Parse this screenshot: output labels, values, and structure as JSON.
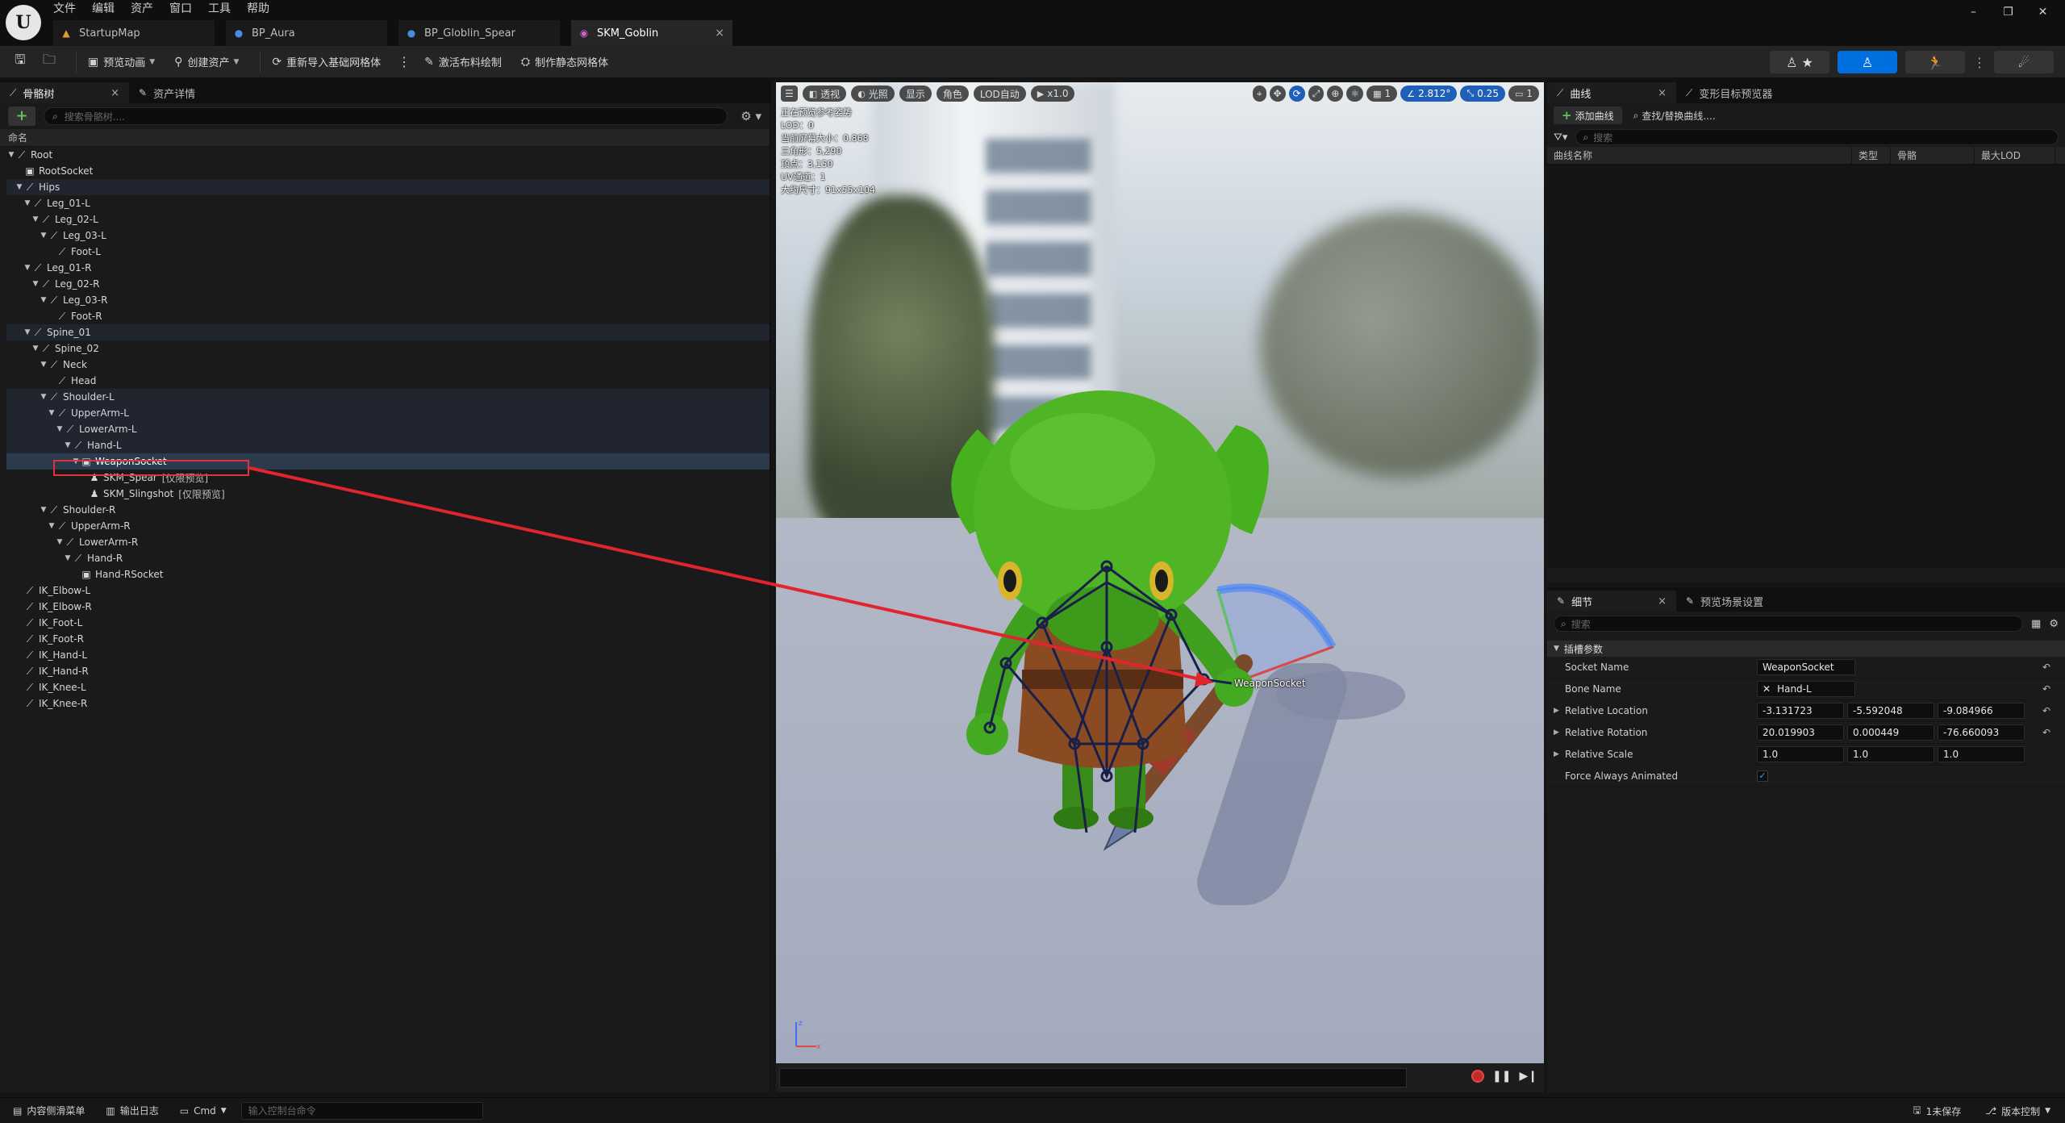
{
  "menu": [
    "文件",
    "编辑",
    "资产",
    "窗口",
    "工具",
    "帮助"
  ],
  "tabs": [
    {
      "label": "StartupMap",
      "icon": "map-icon",
      "active": false
    },
    {
      "label": "BP_Aura",
      "icon": "blueprint-person-icon",
      "active": false
    },
    {
      "label": "BP_Globlin_Spear",
      "icon": "blueprint-person-icon",
      "active": false
    },
    {
      "label": "SKM_Goblin",
      "icon": "skeletal-mesh-icon",
      "active": true
    }
  ],
  "toolbar": {
    "preview_anim": "预览动画",
    "create_asset": "创建资产",
    "reimport": "重新导入基础网格体",
    "activate_cloth": "激活布料绘制",
    "make_static": "制作静态网格体"
  },
  "left_panel": {
    "tab_skeleton": "骨骼树",
    "tab_asset_details": "资产详情",
    "search_placeholder": "搜索骨骼树....",
    "column_name": "命名",
    "tree": [
      {
        "label": "Root",
        "depth": 0,
        "icon": "bone",
        "expanded": true
      },
      {
        "label": "RootSocket",
        "depth": 1,
        "icon": "socket"
      },
      {
        "label": "Hips",
        "depth": 1,
        "icon": "bone",
        "expanded": true,
        "hl": true
      },
      {
        "label": "Leg_01-L",
        "depth": 2,
        "icon": "bone",
        "expanded": true
      },
      {
        "label": "Leg_02-L",
        "depth": 3,
        "icon": "bone",
        "expanded": true
      },
      {
        "label": "Leg_03-L",
        "depth": 4,
        "icon": "bone",
        "expanded": true
      },
      {
        "label": "Foot-L",
        "depth": 5,
        "icon": "bone"
      },
      {
        "label": "Leg_01-R",
        "depth": 2,
        "icon": "bone",
        "expanded": true
      },
      {
        "label": "Leg_02-R",
        "depth": 3,
        "icon": "bone",
        "expanded": true
      },
      {
        "label": "Leg_03-R",
        "depth": 4,
        "icon": "bone",
        "expanded": true
      },
      {
        "label": "Foot-R",
        "depth": 5,
        "icon": "bone"
      },
      {
        "label": "Spine_01",
        "depth": 2,
        "icon": "bone",
        "expanded": true,
        "hl": true
      },
      {
        "label": "Spine_02",
        "depth": 3,
        "icon": "bone",
        "expanded": true
      },
      {
        "label": "Neck",
        "depth": 4,
        "icon": "bone",
        "expanded": true
      },
      {
        "label": "Head",
        "depth": 5,
        "icon": "bone"
      },
      {
        "label": "Shoulder-L",
        "depth": 4,
        "icon": "bone",
        "expanded": true,
        "hl": true
      },
      {
        "label": "UpperArm-L",
        "depth": 5,
        "icon": "bone",
        "expanded": true,
        "hl": true
      },
      {
        "label": "LowerArm-L",
        "depth": 6,
        "icon": "bone",
        "expanded": true,
        "hl": true
      },
      {
        "label": "Hand-L",
        "depth": 7,
        "icon": "bone",
        "expanded": true,
        "hl": true
      },
      {
        "label": "WeaponSocket",
        "depth": 8,
        "icon": "socket",
        "expanded": true,
        "sel": true
      },
      {
        "label": "SKM_Spear",
        "sub": "[仅限预览]",
        "depth": 9,
        "icon": "mesh"
      },
      {
        "label": "SKM_Slingshot",
        "sub": "[仅限预览]",
        "depth": 9,
        "icon": "mesh"
      },
      {
        "label": "Shoulder-R",
        "depth": 4,
        "icon": "bone",
        "expanded": true
      },
      {
        "label": "UpperArm-R",
        "depth": 5,
        "icon": "bone",
        "expanded": true
      },
      {
        "label": "LowerArm-R",
        "depth": 6,
        "icon": "bone",
        "expanded": true
      },
      {
        "label": "Hand-R",
        "depth": 7,
        "icon": "bone",
        "expanded": true
      },
      {
        "label": "Hand-RSocket",
        "depth": 8,
        "icon": "socket"
      },
      {
        "label": "IK_Elbow-L",
        "depth": 1,
        "icon": "bone"
      },
      {
        "label": "IK_Elbow-R",
        "depth": 1,
        "icon": "bone"
      },
      {
        "label": "IK_Foot-L",
        "depth": 1,
        "icon": "bone"
      },
      {
        "label": "IK_Foot-R",
        "depth": 1,
        "icon": "bone"
      },
      {
        "label": "IK_Hand-L",
        "depth": 1,
        "icon": "bone"
      },
      {
        "label": "IK_Hand-R",
        "depth": 1,
        "icon": "bone"
      },
      {
        "label": "IK_Knee-L",
        "depth": 1,
        "icon": "bone"
      },
      {
        "label": "IK_Knee-R",
        "depth": 1,
        "icon": "bone"
      }
    ]
  },
  "viewport": {
    "btn_perspective": "透视",
    "btn_lit": "光照",
    "btn_show": "显示",
    "btn_character": "角色",
    "btn_lod": "LOD自动",
    "btn_speed": "x1.0",
    "grid_value": "1",
    "angle_value": "2.812°",
    "scale_value": "0.25",
    "camera_value": "1",
    "stats": [
      "正在预览参考姿势",
      "LOD：0",
      "当前屏幕大小：0.868",
      "三角形：5,290",
      "顶点：3,150",
      "UV通道：1",
      "大约尺寸：91x55x104"
    ],
    "socket_label": "WeaponSocket"
  },
  "right_top": {
    "tab_curves": "曲线",
    "tab_morph": "变形目标预览器",
    "add_curve": "添加曲线",
    "find_replace": "查找/替换曲线....",
    "search_placeholder": "搜索",
    "columns": [
      "曲线名称",
      "类型",
      "骨骼",
      "最大LOD"
    ]
  },
  "details": {
    "tab_details": "细节",
    "tab_preview_scene": "预览场景设置",
    "search_placeholder": "搜索",
    "category": "插槽参数",
    "socket_name_label": "Socket Name",
    "socket_name": "WeaponSocket",
    "bone_name_label": "Bone Name",
    "bone_name": "Hand-L",
    "rel_location_label": "Relative Location",
    "rel_location": [
      "-3.131723",
      "-5.592048",
      "-9.084966"
    ],
    "rel_rotation_label": "Relative Rotation",
    "rel_rotation": [
      "20.019903",
      "0.000449",
      "-76.660093"
    ],
    "rel_scale_label": "Relative Scale",
    "rel_scale": [
      "1.0",
      "1.0",
      "1.0"
    ],
    "force_anim_label": "Force Always Animated",
    "force_anim_checked": true
  },
  "statusbar": {
    "content_drawer": "内容侧滑菜单",
    "output_log": "输出日志",
    "cmd": "Cmd",
    "console_placeholder": "输入控制台命令",
    "unsaved": "1未保存",
    "source_control": "版本控制"
  },
  "colors": {
    "accent": "#0070e0",
    "selection_box": "#e0323a",
    "arrow": "#e0252e"
  }
}
